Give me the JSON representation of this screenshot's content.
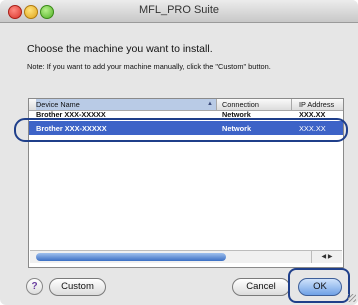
{
  "window": {
    "title": "MFL_PRO Suite"
  },
  "content": {
    "heading": "Choose the machine you want to install.",
    "note": "Note: If you want to add your machine manually, click the \"Custom\" button."
  },
  "table": {
    "columns": [
      "Device Name",
      "Connection",
      "IP Address"
    ],
    "rows": [
      {
        "device": "Brother XXX-XXXXX",
        "connection": "Network",
        "ip": "XXX.XX"
      },
      {
        "device": "Brother XXX-XXXXX",
        "connection": "Network",
        "ip": "XXX.XX"
      }
    ],
    "selected_row": 1,
    "scroll_arrows": "◀ ▶"
  },
  "buttons": {
    "help": "?",
    "custom": "Custom",
    "cancel": "Cancel",
    "ok": "OK"
  }
}
